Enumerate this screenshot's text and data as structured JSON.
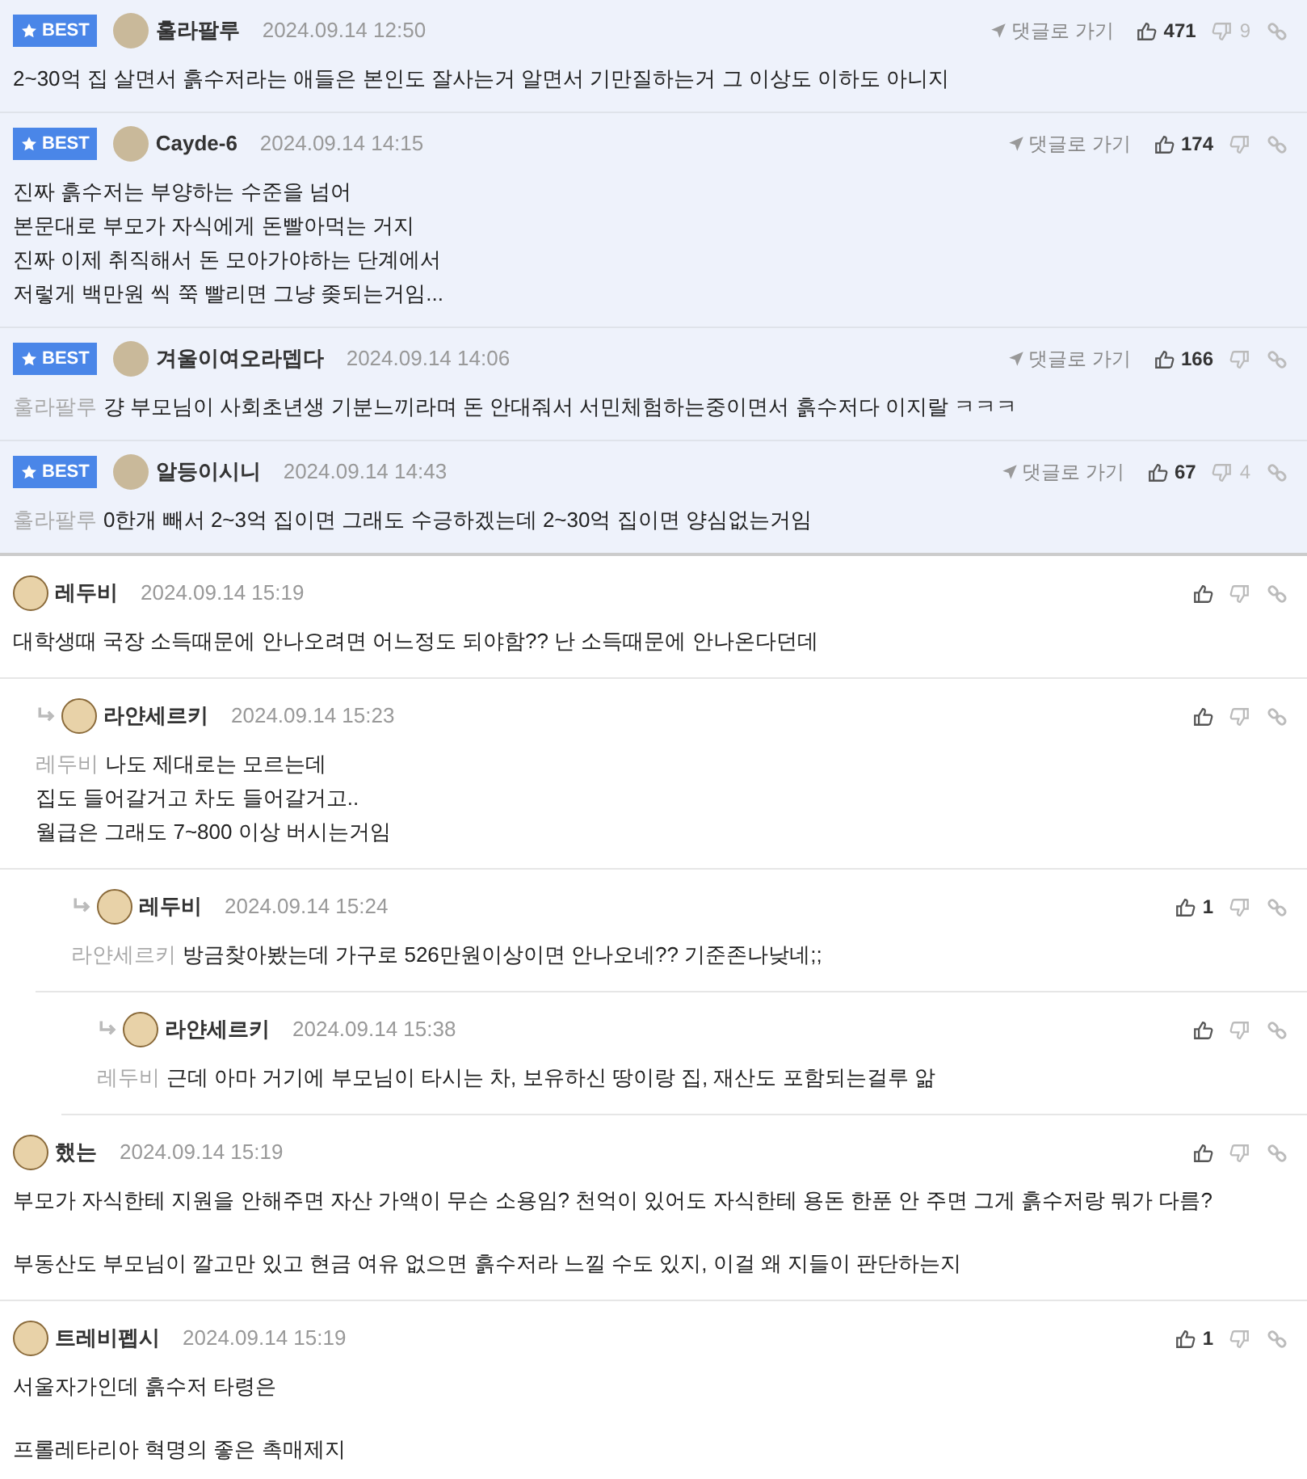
{
  "comments": [
    {
      "best": true,
      "badge": "BEST",
      "author": "훌라팔루",
      "date": "2024.09.14 12:50",
      "goto": "댓글로 가기",
      "likes": "471",
      "dislikes": "9",
      "paragraphs": [
        [
          "2~30억 집 살면서 흙수저라는 애들은 본인도 잘사는거 알면서 기만질하는거 그 이상도 이하도 아니지"
        ]
      ]
    },
    {
      "best": true,
      "badge": "BEST",
      "author": "Cayde-6",
      "date": "2024.09.14 14:15",
      "goto": "댓글로 가기",
      "likes": "174",
      "paragraphs": [
        [
          "진짜 흙수저는 부양하는 수준을 넘어",
          "본문대로 부모가 자식에게 돈빨아먹는 거지",
          "진짜 이제 취직해서 돈 모아가야하는 단계에서",
          "저렇게 백만원 씩 쭉 빨리면 그냥 좆되는거임..."
        ]
      ]
    },
    {
      "best": true,
      "badge": "BEST",
      "author": "겨울이여오라뎁다",
      "date": "2024.09.14 14:06",
      "goto": "댓글로 가기",
      "likes": "166",
      "reply_to": "훌라팔루",
      "paragraphs": [
        [
          "걍 부모님이 사회초년생 기분느끼라며 돈 안대줘서 서민체험하는중이면서 흙수저다 이지랄 ㅋㅋㅋ"
        ]
      ]
    },
    {
      "best": true,
      "badge": "BEST",
      "author": "알등이시니",
      "date": "2024.09.14 14:43",
      "goto": "댓글로 가기",
      "likes": "67",
      "dislikes": "4",
      "reply_to": "훌라팔루",
      "paragraphs": [
        [
          "0한개 빼서 2~3억 집이면 그래도 수긍하겠는데 2~30억 집이면 양심없는거임"
        ]
      ]
    },
    {
      "best": false,
      "author": "레두비",
      "date": "2024.09.14 15:19",
      "paragraphs": [
        [
          "대학생때 국장 소득때문에 안나오려면 어느정도 되야함?? 난 소득때문에 안나온다던데"
        ]
      ],
      "children": [
        {
          "best": false,
          "author": "라얀세르키",
          "date": "2024.09.14 15:23",
          "reply_to": "레두비",
          "paragraphs": [
            [
              "나도 제대로는 모르는데",
              "집도 들어갈거고 차도 들어갈거고..",
              "월급은 그래도 7~800 이상 버시는거임"
            ]
          ],
          "children": [
            {
              "best": false,
              "author": "레두비",
              "date": "2024.09.14 15:24",
              "likes": "1",
              "reply_to": "라얀세르키",
              "paragraphs": [
                [
                  "방금찾아봤는데 가구로 526만원이상이면 안나오네?? 기준존나낮네;;"
                ]
              ],
              "children": [
                {
                  "best": false,
                  "author": "라얀세르키",
                  "date": "2024.09.14 15:38",
                  "reply_to": "레두비",
                  "paragraphs": [
                    [
                      "근데 아마 거기에 부모님이 타시는 차, 보유하신 땅이랑 집, 재산도 포함되는걸루 앎"
                    ]
                  ]
                }
              ]
            }
          ]
        }
      ]
    },
    {
      "best": false,
      "author": "했는",
      "date": "2024.09.14 15:19",
      "paragraphs": [
        [
          "부모가 자식한테 지원을 안해주면 자산 가액이 무슨 소용임? 천억이 있어도 자식한테 용돈 한푼 안 주면 그게 흙수저랑 뭐가 다름?"
        ],
        [
          "부동산도 부모님이 깔고만 있고 현금 여유 없으면 흙수저라 느낄 수도 있지, 이걸 왜 지들이 판단하는지"
        ]
      ]
    },
    {
      "best": false,
      "author": "트레비펩시",
      "date": "2024.09.14 15:19",
      "likes": "1",
      "paragraphs": [
        [
          "서울자가인데 흙수저 타령은"
        ],
        [
          "프롤레타리아 혁명의 좋은 촉매제지"
        ]
      ]
    }
  ]
}
